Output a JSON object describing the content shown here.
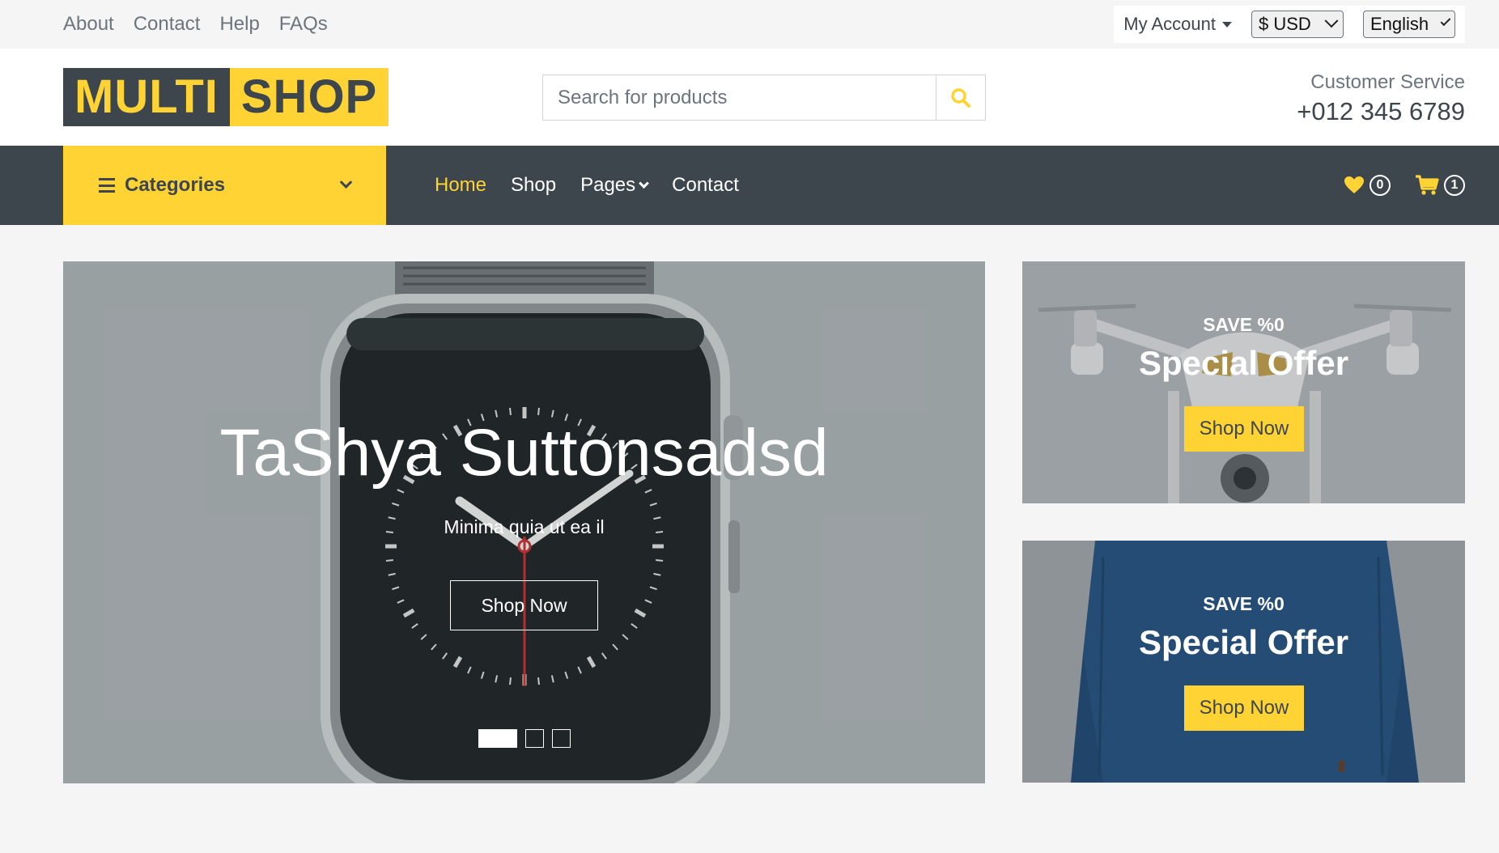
{
  "topbar": {
    "links": [
      "About",
      "Contact",
      "Help",
      "FAQs"
    ],
    "my_account": "My Account",
    "currency": "$ USD",
    "language": "English"
  },
  "header": {
    "logo_part1": "MULTI",
    "logo_part2": "SHOP",
    "search_placeholder": "Search for products",
    "search_icon": "search-icon",
    "cs_label": "Customer Service",
    "cs_phone": "+012 345 6789"
  },
  "nav": {
    "categories_label": "Categories",
    "links": [
      "Home",
      "Shop",
      "Pages",
      "Contact"
    ],
    "active": "Home",
    "wishlist_count": "0",
    "cart_count": "1"
  },
  "hero": {
    "title": "TaShya Suttonsadsd",
    "subtitle": "Minima quia ut ea il",
    "button": "Shop Now",
    "slides": 3,
    "active_slide": 1
  },
  "offers": [
    {
      "save": "SAVE %0",
      "title": "Special Offer",
      "button": "Shop Now"
    },
    {
      "save": "SAVE %0",
      "title": "Special Offer",
      "button": "Shop Now"
    }
  ],
  "colors": {
    "primary": "#FFD333",
    "dark": "#3D464D",
    "light": "#F5F5F5",
    "muted": "#6C757D"
  }
}
